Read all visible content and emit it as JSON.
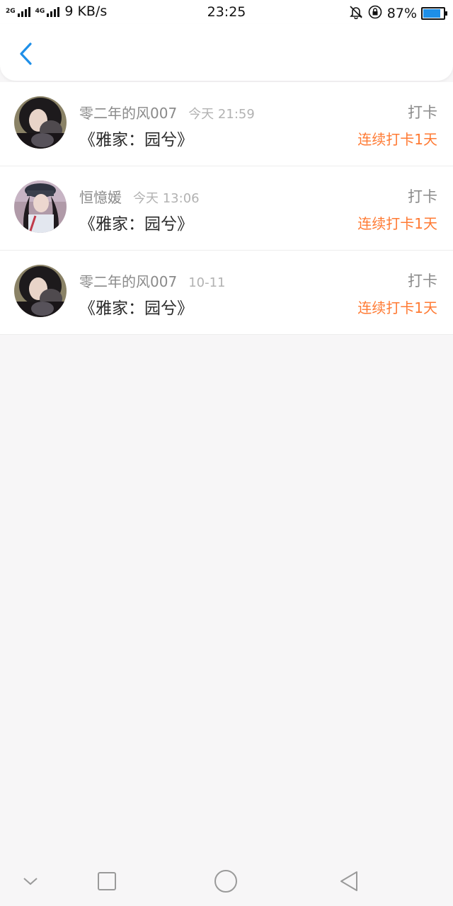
{
  "status_bar": {
    "network_left": "2G",
    "network_right": "4G",
    "speed": "9 KB/s",
    "time": "23:25",
    "battery_pct": "87%",
    "battery_level": 0.87
  },
  "header": {
    "back_icon": "chevron-left-icon",
    "accent": "#1e8fe8"
  },
  "entries": [
    {
      "name": "零二年的风007",
      "time": "今天 21:59",
      "book": "《雅家：园兮》",
      "type": "打卡",
      "streak": "连续打卡1天"
    },
    {
      "name": "恒憶媛",
      "time": "今天 13:06",
      "book": "《雅家：园兮》",
      "type": "打卡",
      "streak": "连续打卡1天"
    },
    {
      "name": "零二年的风007",
      "time": "10-11",
      "book": "《雅家：园兮》",
      "type": "打卡",
      "streak": "连续打卡1天"
    }
  ],
  "colors": {
    "streak": "#ff7a33",
    "muted": "#8a8a8a",
    "title": "#2b2b2b"
  },
  "nav_bar": [
    "chevron-down-icon",
    "square-icon",
    "circle-icon",
    "triangle-back-icon"
  ]
}
